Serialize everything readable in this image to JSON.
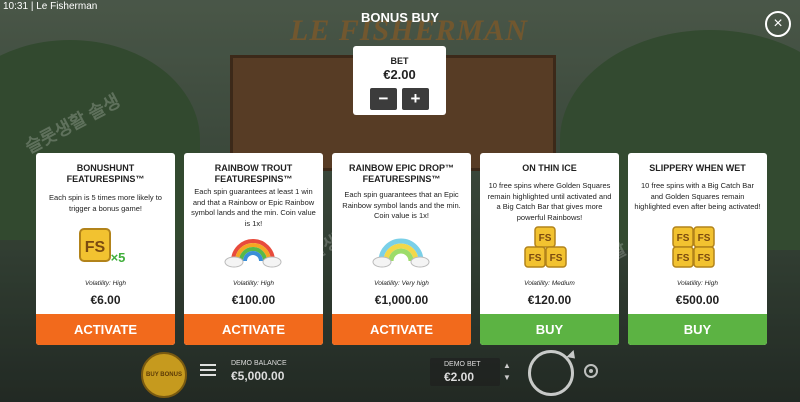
{
  "status_bar": {
    "time": "10:31",
    "app_name": "Le Fisherman"
  },
  "modal": {
    "title": "BONUS BUY",
    "close_icon": "close-icon",
    "bet": {
      "label": "BET",
      "value": "€2.00",
      "minus": "−",
      "plus": "+"
    }
  },
  "game_logo": "LE FISHERMAN",
  "cards": [
    {
      "title": "BONUSHUNT FEATURESPINS™",
      "description": "Each spin is 5 times more likely to trigger a bonus game!",
      "icon": "fs-x5-icon",
      "volatility": "Volatility: High",
      "price": "€6.00",
      "button": "ACTIVATE",
      "button_color": "#f26a1c"
    },
    {
      "title": "RAINBOW TROUT FEATURESPINS™",
      "description": "Each spin guarantees at least 1 win and that a Rainbow or Epic Rainbow symbol lands and the min. Coin value is 1x!",
      "icon": "rainbow-icon",
      "volatility": "Volatility: High",
      "price": "€100.00",
      "button": "ACTIVATE",
      "button_color": "#f26a1c"
    },
    {
      "title": "RAINBOW EPIC DROP™ FEATURESPINS™",
      "description": "Each spin guarantees that an Epic Rainbow symbol lands and the min. Coin value is 1x!",
      "icon": "epic-rainbow-icon",
      "volatility": "Volatility: Very high",
      "price": "€1,000.00",
      "button": "ACTIVATE",
      "button_color": "#f26a1c"
    },
    {
      "title": "ON THIN ICE",
      "description": "10 free spins where Golden Squares remain highlighted until activated and a Big Catch Bar that gives more powerful Rainbows!",
      "icon": "fs-stack-icon",
      "volatility": "Volatility: Medium",
      "price": "€120.00",
      "button": "BUY",
      "button_color": "#5cb343"
    },
    {
      "title": "SLIPPERY WHEN WET",
      "description": "10 free spins with a Big Catch Bar and Golden Squares remain highlighted even after being activated!",
      "icon": "fs-stack-large-icon",
      "volatility": "Volatility: High",
      "price": "€500.00",
      "button": "BUY",
      "button_color": "#5cb343"
    }
  ],
  "bottom_bar": {
    "buy_bonus_label": "BUY BONUS",
    "menu_icon": "menu-icon",
    "demo_balance_label": "DEMO BALANCE",
    "demo_balance_value": "€5,000.00",
    "demo_bet_label": "DEMO BET",
    "demo_bet_value": "€2.00",
    "spin_icon": "spin-icon",
    "autoplay_icon": "autoplay-icon"
  },
  "watermark_text": "슬롯생활 솔생"
}
